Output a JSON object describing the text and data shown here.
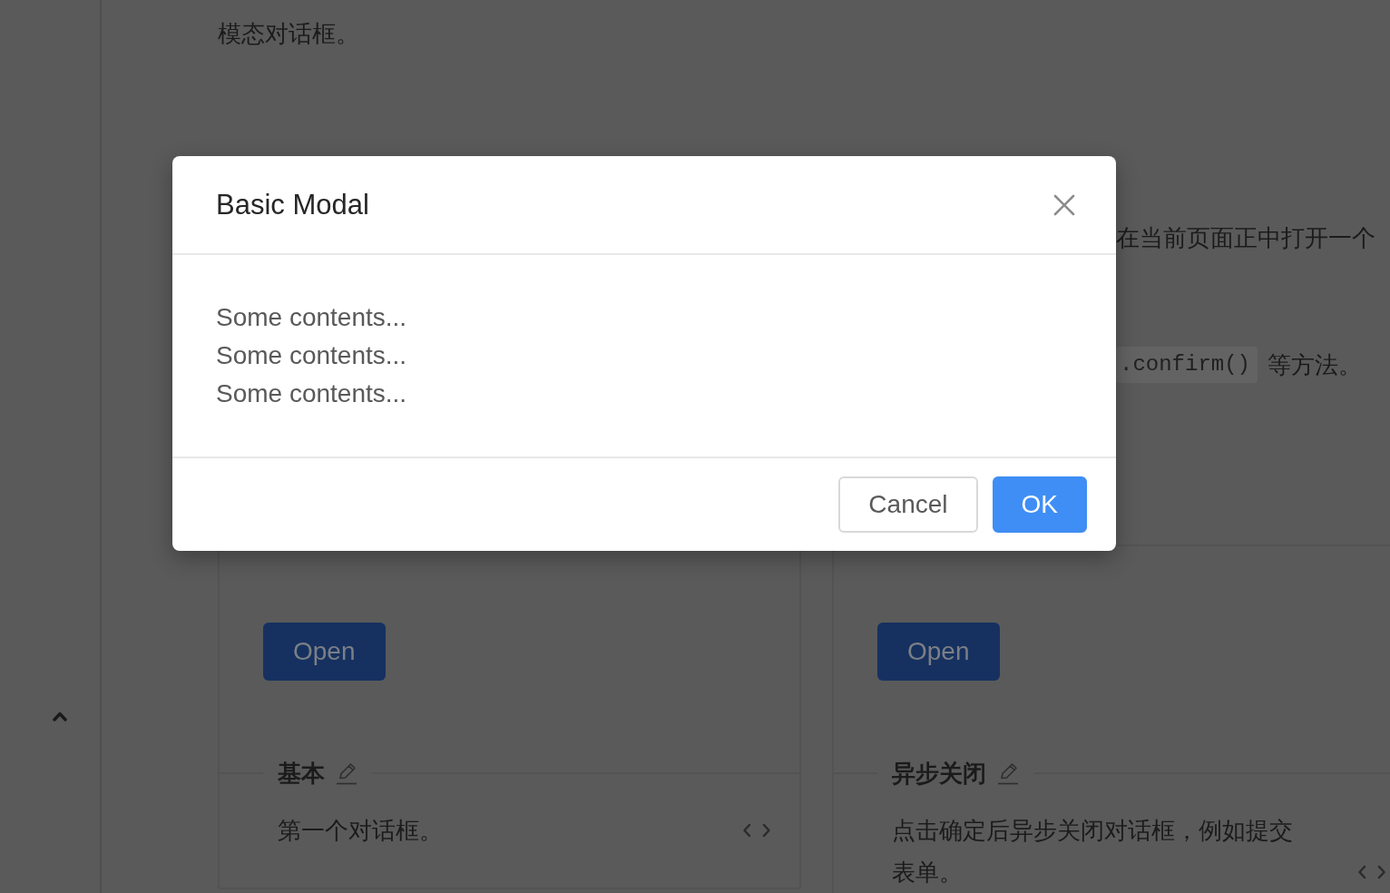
{
  "content": {
    "intro": "模态对话框。",
    "lines": [
      {
        "segments": [
          {
            "kind": "text",
            "text": "在当前页面正中打开一个"
          }
        ]
      },
      {
        "segments": [
          {
            "kind": "code",
            "text": ".confirm()"
          },
          {
            "kind": "text",
            "text": "等方法。"
          }
        ]
      }
    ],
    "demos": [
      {
        "button": "Open",
        "title": "基本",
        "description": "第一个对话框。"
      },
      {
        "button": "Open",
        "title": "异步关闭",
        "description": "点击确定后异步关闭对话框，例如提交表单。"
      }
    ]
  },
  "modal": {
    "title": "Basic Modal",
    "body": [
      "Some contents...",
      "Some contents...",
      "Some contents..."
    ],
    "buttons": [
      {
        "label": "Cancel",
        "kind": "default"
      },
      {
        "label": "OK",
        "kind": "primary"
      }
    ]
  }
}
